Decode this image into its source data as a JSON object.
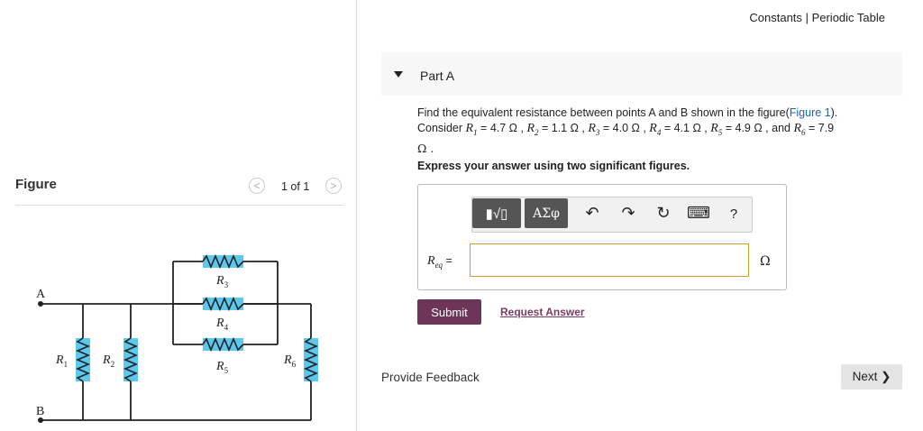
{
  "topnav": {
    "constants": "Constants",
    "separator": "|",
    "periodic_table": "Periodic Table"
  },
  "figure": {
    "title": "Figure",
    "pager": "1 of 1",
    "prev": "<",
    "next": ">"
  },
  "circuit": {
    "labels": {
      "A": "A",
      "B": "B",
      "R1": "R",
      "R2": "R",
      "R3": "R",
      "R4": "R",
      "R5": "R",
      "R6": "R",
      "s1": "1",
      "s2": "2",
      "s3": "3",
      "s4": "4",
      "s5": "5",
      "s6": "6"
    }
  },
  "part": {
    "title": "Part A"
  },
  "problem": {
    "line1_prefix": "Find the equivalent resistance between points A and B shown in the figure(",
    "link": "Figure 1",
    "line1_suffix": ").",
    "consider": "Consider",
    "values": [
      {
        "sym": "R",
        "sub": "1",
        "val": "= 4.7 Ω ,"
      },
      {
        "sym": "R",
        "sub": "2",
        "val": "= 1.1 Ω ,"
      },
      {
        "sym": "R",
        "sub": "3",
        "val": "= 4.0 Ω ,"
      },
      {
        "sym": "R",
        "sub": "4",
        "val": "= 4.1 Ω ,"
      },
      {
        "sym": "R",
        "sub": "5",
        "val": "= 4.9 Ω , and"
      },
      {
        "sym": "R",
        "sub": "6",
        "val": "= 7.9"
      }
    ],
    "trail": "Ω ."
  },
  "instruction": "Express your answer using two significant figures.",
  "toolbar": {
    "template_btn": "▮√▯",
    "greek_btn": "ΑΣφ",
    "undo": "↶",
    "redo": "↷",
    "reset": "↻",
    "keyboard": "⌨",
    "help": "?"
  },
  "answer": {
    "label_main": "R",
    "label_sub": "eq",
    "equals": "=",
    "value": "",
    "unit": "Ω"
  },
  "buttons": {
    "submit": "Submit",
    "request": "Request Answer",
    "feedback": "Provide Feedback",
    "next": "Next ❯"
  }
}
